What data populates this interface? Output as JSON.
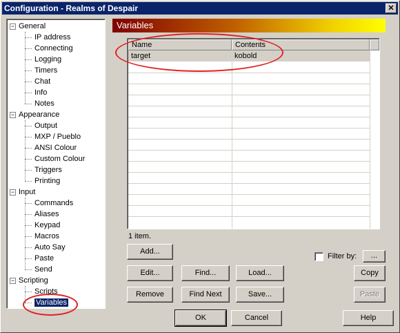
{
  "window": {
    "title": "Configuration - Realms of Despair",
    "close_label": "✕"
  },
  "tree": {
    "categories": [
      {
        "label": "General",
        "expander": "−",
        "children": [
          "IP address",
          "Connecting",
          "Logging",
          "Timers",
          "Chat",
          "Info",
          "Notes"
        ]
      },
      {
        "label": "Appearance",
        "expander": "−",
        "children": [
          "Output",
          "MXP / Pueblo",
          "ANSI Colour",
          "Custom Colour",
          "Triggers",
          "Printing"
        ]
      },
      {
        "label": "Input",
        "expander": "−",
        "children": [
          "Commands",
          "Aliases",
          "Keypad",
          "Macros",
          "Auto Say",
          "Paste",
          "Send"
        ]
      },
      {
        "label": "Scripting",
        "expander": "−",
        "children": [
          "Scripts",
          "Variables"
        ]
      }
    ],
    "selected": "Variables"
  },
  "panel": {
    "title": "Variables"
  },
  "list": {
    "columns": [
      "Name",
      "Contents"
    ],
    "rows": [
      {
        "name": "target",
        "contents": "kobold"
      }
    ],
    "status": "1 item."
  },
  "buttons": {
    "add": "Add...",
    "edit": "Edit...",
    "remove": "Remove",
    "find": "Find...",
    "find_next": "Find Next",
    "load": "Load...",
    "save": "Save...",
    "copy": "Copy",
    "paste": "Paste",
    "filter_dots": "...",
    "ok": "OK",
    "cancel": "Cancel",
    "help": "Help"
  },
  "filter": {
    "label": "Filter by:",
    "checked": false
  },
  "colors": {
    "title_bar": "#0a246a",
    "selection": "#0a246a",
    "annotation": "#e02020"
  }
}
